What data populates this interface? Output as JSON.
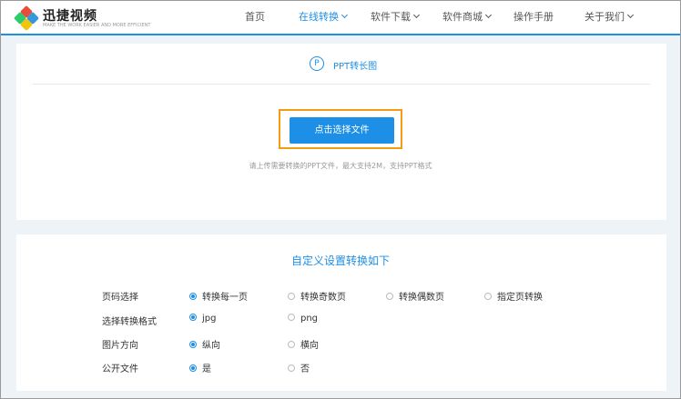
{
  "header": {
    "brand": "迅捷视频",
    "brand_sub": "MAKE THE WORK EASIER AND MORE EFFICIENT",
    "nav": [
      {
        "label": "首页"
      },
      {
        "label": "在线转换",
        "active": true
      },
      {
        "label": "软件下载"
      },
      {
        "label": "软件商城"
      },
      {
        "label": "操作手册"
      },
      {
        "label": "关于我们"
      }
    ],
    "logo_colors": [
      "#e74c3c",
      "#2ecc71",
      "#3498db",
      "#f1c40f"
    ]
  },
  "upload": {
    "icon_letter": "P",
    "title": "PPT转长图",
    "button": "点击选择文件",
    "hint": "请上传需要转换的PPT文件，最大支持2M，支持PPT格式"
  },
  "settings": {
    "title": "自定义设置转换如下",
    "rows": [
      {
        "label": "页码选择",
        "options": [
          "转换每一页",
          "转换奇数页",
          "转换偶数页",
          "指定页转换"
        ],
        "selected": 0
      },
      {
        "label": "选择转换格式",
        "options": [
          "jpg",
          "png"
        ],
        "selected": 0
      },
      {
        "label": "图片方向",
        "options": [
          "纵向",
          "横向"
        ],
        "selected": 0
      },
      {
        "label": "公开文件",
        "options": [
          "是",
          "否"
        ],
        "selected": 0
      }
    ]
  },
  "colors": {
    "accent": "#1e8fe6",
    "highlight": "#f39c12"
  }
}
